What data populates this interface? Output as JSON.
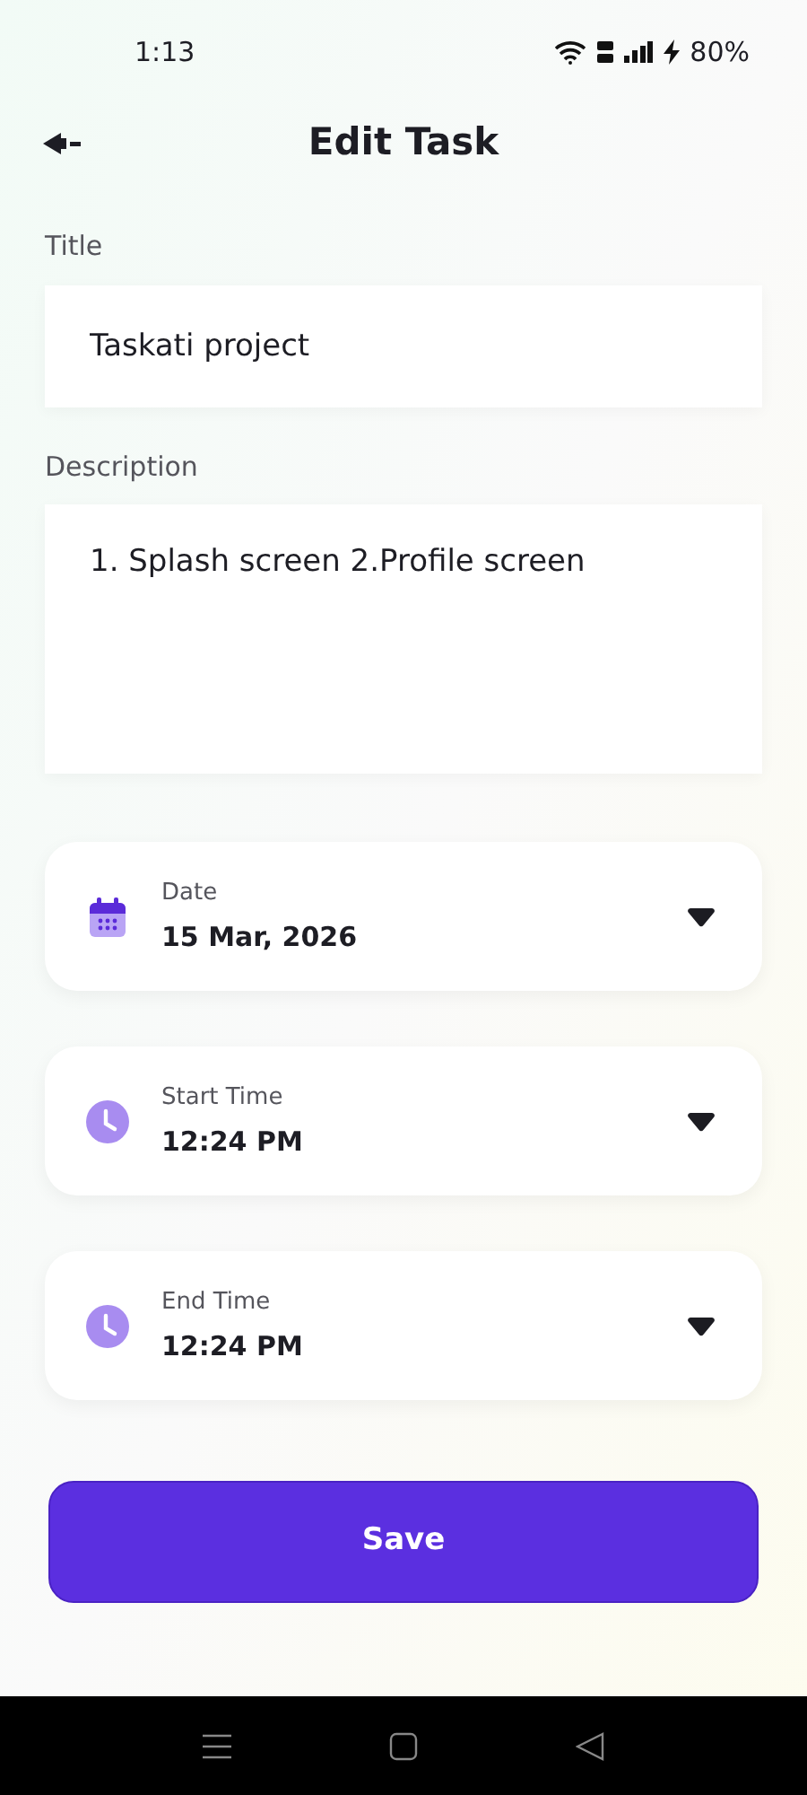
{
  "status_bar": {
    "time": "1:13",
    "battery": "80%"
  },
  "header": {
    "title": "Edit Task"
  },
  "fields": [
    {
      "label": "Title",
      "value": "Taskati project",
      "kind": "line"
    },
    {
      "label": "Description",
      "value": "1. Splash screen 2.Profile screen",
      "kind": "area"
    }
  ],
  "pickers": [
    {
      "kind": "date",
      "label": "Date",
      "value": "15 Mar, 2026"
    },
    {
      "kind": "time",
      "label": "Start Time",
      "value": "12:24 PM"
    },
    {
      "kind": "time",
      "label": "End Time",
      "value": "12:24 PM"
    }
  ],
  "save_button": "Save"
}
